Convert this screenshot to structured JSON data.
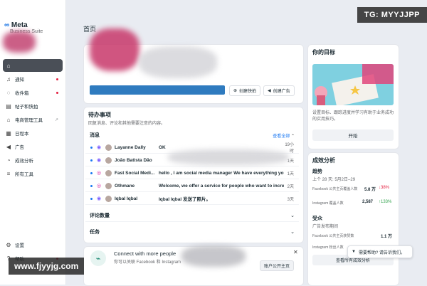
{
  "watermarks": {
    "top": "TG: MYYJJPP",
    "bottom": "www.fjyyjg.com"
  },
  "sidebar": {
    "brand": "Meta",
    "brand_sub": "Business Suite",
    "items": [
      {
        "label": "",
        "icon": "home-icon"
      },
      {
        "label": "通知",
        "icon": "bell-icon"
      },
      {
        "label": "收件箱",
        "icon": "chat-icon"
      },
      {
        "label": "帖子和快拍",
        "icon": "posts-icon"
      },
      {
        "label": "电商管理工具",
        "icon": "shop-icon"
      },
      {
        "label": "日程本",
        "icon": "calendar-icon"
      },
      {
        "label": "广告",
        "icon": "megaphone-icon"
      },
      {
        "label": "成效分析",
        "icon": "chart-icon"
      },
      {
        "label": "所有工具",
        "icon": "menu-icon"
      }
    ],
    "bottom": [
      {
        "label": "设置",
        "icon": "gear-icon"
      },
      {
        "label": "帮助",
        "icon": "help-icon"
      }
    ]
  },
  "main": {
    "title": "首页",
    "create_post": "创建快拍",
    "create_ad": "创建广告",
    "todo": {
      "title": "待办事项",
      "subtitle": "回复消息、评论和其他需要注意的内容。",
      "messages_label": "消息",
      "view_all": "查看全部",
      "rows": [
        {
          "platform": "messenger",
          "name": "Layanne Dally",
          "message": "OK",
          "time": "19小时"
        },
        {
          "platform": "messenger",
          "name": "João Batista Dão",
          "message": "",
          "time": "1天"
        },
        {
          "platform": "instagram",
          "name": "Fast Social Medi...",
          "message": "hello , I am social media manager We have everything you ne",
          "time": "1天"
        },
        {
          "platform": "instagram",
          "name": "Othmane",
          "message": "Welcome, we offer a service for people who want to increase",
          "time": "2天"
        },
        {
          "platform": "messenger",
          "name": "Iqbal Iqbal",
          "message": "Iqbal Iqbal 发送了照片。",
          "time": "3天"
        }
      ],
      "comments_label": "评论数量",
      "tasks_label": "任务"
    },
    "connect": {
      "title": "Connect with more people",
      "subtitle": "你可以关联 Facebook 和 Instagram",
      "button": "账户公开主页"
    }
  },
  "right": {
    "goals": {
      "title": "你的目标",
      "desc": "设置目标、跟踪进度并学习有助于业务成功的实用技巧。",
      "button": "开始"
    },
    "insights": {
      "title": "成效分析",
      "trend_title": "趋势",
      "trend_range": "上个 28 天: 5月2日–29",
      "fb_label": "Facebook 公共主页覆盖人数",
      "fb_value": "5.8 万",
      "fb_change": "38%",
      "ig_label": "Instagram 覆盖人数",
      "ig_value": "2,587",
      "ig_change": "133%",
      "audience_title": "受众",
      "audience_sub": "广告发布期间",
      "fb_fans_label": "Facebook 公共主页获赞数",
      "fb_fans_value": "1.1 万",
      "ig_fans_label": "Instagram 粉丝人数",
      "view_more": "查看所有成效分析"
    }
  },
  "help_chat": "需要帮助? 请告诉我们。",
  "colors": {
    "accent": "#1877f2",
    "banner": "#2f7bbf",
    "active_nav": "#4a4f57",
    "positive": "#31a24c",
    "negative": "#e41e3f"
  }
}
